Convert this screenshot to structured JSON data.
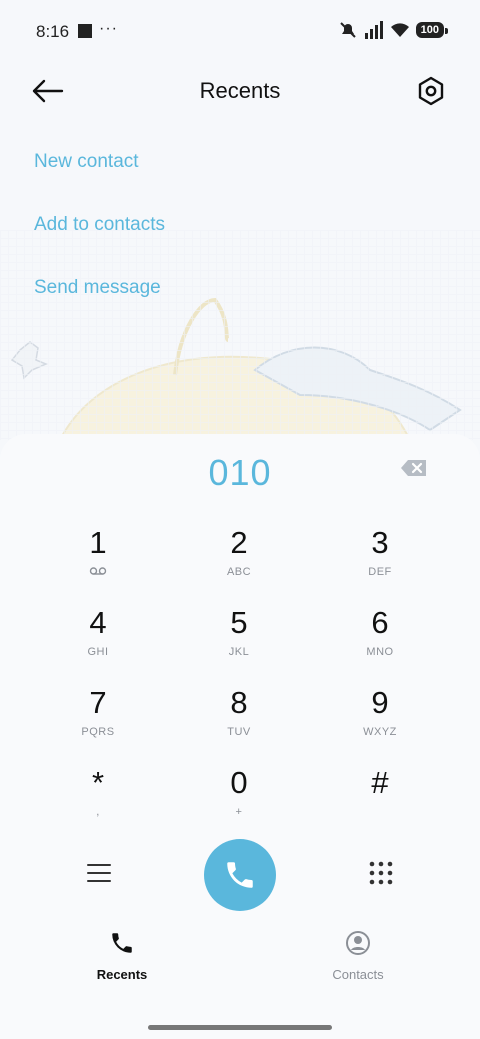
{
  "status_bar": {
    "time": "8:16",
    "dots": "···",
    "battery": "100"
  },
  "header": {
    "title": "Recents"
  },
  "actions": [
    {
      "label": "New contact"
    },
    {
      "label": "Add to contacts"
    },
    {
      "label": "Send message"
    }
  ],
  "dialpad": {
    "number": "010",
    "keys": [
      {
        "digit": "1",
        "letters": ""
      },
      {
        "digit": "2",
        "letters": "ABC"
      },
      {
        "digit": "3",
        "letters": "DEF"
      },
      {
        "digit": "4",
        "letters": "GHI"
      },
      {
        "digit": "5",
        "letters": "JKL"
      },
      {
        "digit": "6",
        "letters": "MNO"
      },
      {
        "digit": "7",
        "letters": "PQRS"
      },
      {
        "digit": "8",
        "letters": "TUV"
      },
      {
        "digit": "9",
        "letters": "WXYZ"
      },
      {
        "digit": "*",
        "letters": ","
      },
      {
        "digit": "0",
        "letters": "+"
      },
      {
        "digit": "#",
        "letters": ""
      }
    ]
  },
  "bottom_nav": {
    "recents": "Recents",
    "contacts": "Contacts"
  },
  "colors": {
    "accent": "#5ab7dc",
    "text": "#111111",
    "muted": "#8b8f96"
  },
  "icons": [
    "back-arrow-icon",
    "settings-hex-icon",
    "backspace-icon",
    "voicemail-icon",
    "menu-icon",
    "call-icon",
    "keypad-icon",
    "phone-icon",
    "contacts-icon"
  ]
}
